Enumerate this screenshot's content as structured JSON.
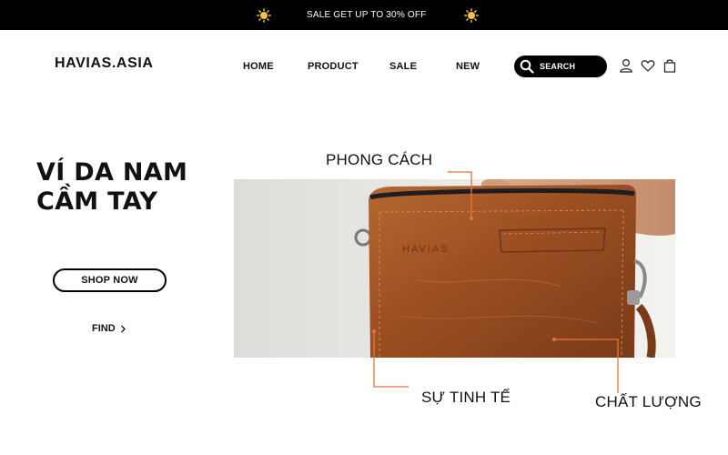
{
  "promo": {
    "text": "SALE GET UP TO 30% OFF"
  },
  "header": {
    "logo": "HAVIAS.ASIA",
    "nav": [
      "HOME",
      "PRODUCT",
      "SALE",
      "NEW"
    ],
    "search_label": "SEARCH",
    "icons": [
      "user-icon",
      "heart-icon",
      "cart-icon"
    ]
  },
  "hero": {
    "title_line1": "VÍ DA NAM",
    "title_line2": "CẦM TAY",
    "shop_button": "SHOP NOW",
    "find_link": "FIND",
    "brand_emboss": "HAVIAS"
  },
  "callouts": {
    "style": "PHONG CÁCH",
    "refinement": "SỰ TINH TẾ",
    "quality": "CHẤT LƯỢNG"
  },
  "colors": {
    "promo_bg": "#000000",
    "accent_line": "#e8743b",
    "leather": "#a0522d",
    "sun": "#f5c542"
  }
}
